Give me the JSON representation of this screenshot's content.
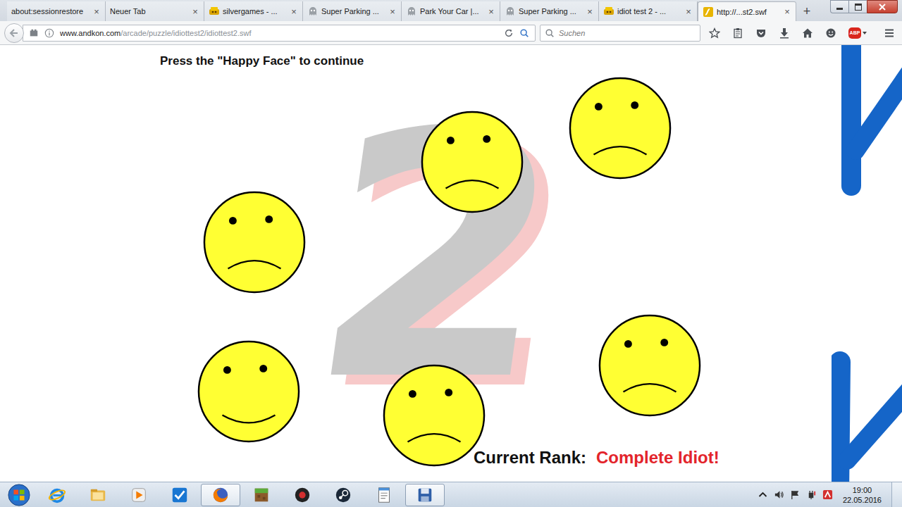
{
  "browser": {
    "tabs": [
      {
        "label": "about:sessionrestore",
        "selected": false,
        "kind": "none"
      },
      {
        "label": "Neuer Tab",
        "selected": false,
        "kind": "none"
      },
      {
        "label": "silvergames - ...",
        "selected": false,
        "kind": "game"
      },
      {
        "label": "Super Parking ...",
        "selected": false,
        "kind": "ghost"
      },
      {
        "label": "Park Your Car |...",
        "selected": false,
        "kind": "ghost"
      },
      {
        "label": "Super Parking ...",
        "selected": false,
        "kind": "ghost"
      },
      {
        "label": "idiot test 2 - ...",
        "selected": false,
        "kind": "game"
      },
      {
        "label": "http://...st2.swf",
        "selected": true,
        "kind": "flash"
      }
    ],
    "tab_close": "×",
    "new_tab": "+",
    "url_host": "www.andkon.com",
    "url_path": "/arcade/puzzle/idiottest2/idiottest2.swf",
    "search_placeholder": "Suchen",
    "abp_label": "ABP"
  },
  "game": {
    "instruction": "Press the \"Happy Face\" to continue",
    "numeral": "2",
    "faces": [
      {
        "happy": false
      },
      {
        "happy": false
      },
      {
        "happy": false
      },
      {
        "happy": true
      },
      {
        "happy": false
      },
      {
        "happy": false
      }
    ],
    "rank_label": "Current Rank:",
    "rank_value": "Complete Idiot!"
  },
  "taskbar": {
    "apps": [
      {
        "kind": "ie",
        "active": false
      },
      {
        "kind": "explorer",
        "active": false
      },
      {
        "kind": "media",
        "active": false
      },
      {
        "kind": "check",
        "active": false
      },
      {
        "kind": "firefox",
        "active": true
      },
      {
        "kind": "minecraft",
        "active": false
      },
      {
        "kind": "record",
        "active": false
      },
      {
        "kind": "steam",
        "active": false
      },
      {
        "kind": "notepad",
        "active": false
      },
      {
        "kind": "save",
        "active": true
      }
    ],
    "time": "19:00",
    "date": "22.05.2016"
  }
}
